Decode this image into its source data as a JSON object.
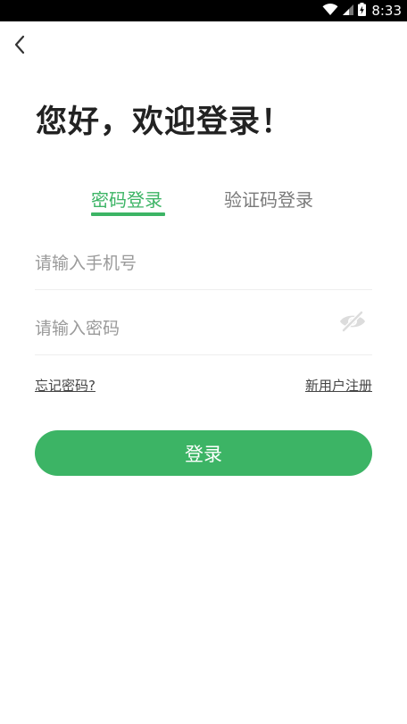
{
  "status_bar": {
    "time": "8:33",
    "icons": [
      "wifi-icon",
      "cellular-signal-icon",
      "battery-charging-icon"
    ]
  },
  "header": {
    "back_icon": "chevron-left-icon"
  },
  "greeting": "您好，欢迎登录！",
  "tabs": [
    {
      "label": "密码登录",
      "active": true
    },
    {
      "label": "验证码登录",
      "active": false
    }
  ],
  "form": {
    "phone_placeholder": "请输入手机号",
    "phone_value": "",
    "password_placeholder": "请输入密码",
    "password_value": "",
    "password_toggle_icon": "eye-hidden-icon"
  },
  "links": {
    "forgot_password": "忘记密码?",
    "register": "新用户注册"
  },
  "login_button": "登录",
  "colors": {
    "accent": "#3cb465",
    "status_bar": "#000000",
    "title_text": "#222222",
    "placeholder": "#9a9a9a"
  }
}
